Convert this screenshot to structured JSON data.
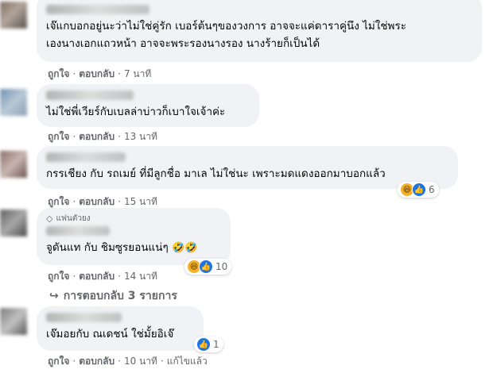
{
  "comments": [
    {
      "lines": [
        "เจ๊แกบอกอยู่นะว่าไม่ใช่คู่รัก เบอร์ต้นๆของวงการ อาจจะแค่ดาราคู่นึง ไม่ใช่พระ",
        "เองนางเอกแถวหน้า อาจจะพระรองนางรอง นางร้ายก็เป็นได้"
      ],
      "like": "ถูกใจ",
      "reply": "ตอบกลับ",
      "time": "7 นาที"
    },
    {
      "lines": [
        "ไม่ใช่พี่เวียร์กับเบลล่าบ่าวก็เบาใจเจ้าค่ะ"
      ],
      "like": "ถูกใจ",
      "reply": "ตอบกลับ",
      "time": "13 นาที"
    },
    {
      "lines": [
        "กรรเชียง กับ รถเมย์ ที่มีลูกชื่อ มาเล ไม่ใช่นะ เพราะมดแดงออกมาบอกแล้ว"
      ],
      "like": "ถูกใจ",
      "reply": "ตอบกลับ",
      "time": "15 นาที",
      "reaction_count": "6"
    },
    {
      "badge": "แฟนตัวยง",
      "lines": [
        "จูดันแท กับ ชิมซูรยอนแน่ๆ"
      ],
      "like": "ถูกใจ",
      "reply": "ตอบกลับ",
      "time": "14 นาที",
      "reaction_count": "10"
    },
    {
      "lines": [
        "เจ๊มอยกับ ณเดชน์ ใช่มั้ยอิเจ๊"
      ],
      "like": "ถูกใจ",
      "reply": "ตอบกลับ",
      "time": "10 นาที",
      "edited": "แก้ไขแล้ว",
      "reaction_count": "1"
    }
  ],
  "view_replies": "การตอบกลับ 3 รายการ",
  "icons": {
    "haha": "haha-reaction-icon",
    "like": "like-reaction-icon",
    "reply_arrow": "reply-arrow-icon",
    "fan_badge": "diamond-icon"
  },
  "colors": {
    "bubble": "#f0f2f5",
    "muted": "#65676b",
    "like_blue": "#1b74e4",
    "haha_yellow": "#f7b125"
  }
}
